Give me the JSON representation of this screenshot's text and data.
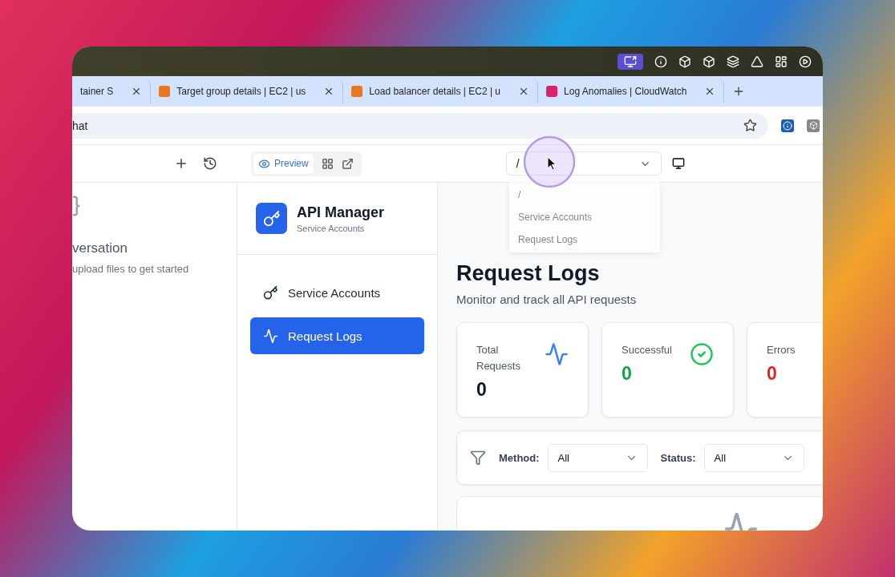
{
  "browser_tabs": [
    {
      "title": "tainer S",
      "selected": false
    },
    {
      "title": "Target group details | EC2 | us",
      "selected": false,
      "color": "#e8771e"
    },
    {
      "title": "Load balancer details | EC2 | u",
      "selected": false,
      "color": "#e8771e"
    },
    {
      "title": "Log Anomalies | CloudWatch",
      "selected": false,
      "color": "#d6246e"
    }
  ],
  "address_bar": {
    "value": "hat"
  },
  "toolbar": {
    "preview_label": "Preview",
    "path_select": {
      "value": "/"
    },
    "path_menu": [
      "/",
      "Service Accounts",
      "Request Logs"
    ]
  },
  "chat_panel": {
    "title": "versation",
    "hint": "upload files to get started"
  },
  "sidebar": {
    "app_name": "API Manager",
    "app_subtitle": "Service Accounts",
    "items": [
      {
        "label": "Service Accounts",
        "kind": "key",
        "selected": false
      },
      {
        "label": "Request Logs",
        "kind": "activity",
        "selected": true
      }
    ]
  },
  "page": {
    "title": "Request Logs",
    "subtitle": "Monitor and track all API requests",
    "stats": [
      {
        "label": "Total Requests",
        "value": "0",
        "kind": "total"
      },
      {
        "label": "Successful",
        "value": "0",
        "kind": "success"
      },
      {
        "label": "Errors",
        "value": "0",
        "kind": "error"
      }
    ],
    "filters": [
      {
        "label": "Method:",
        "value": "All"
      },
      {
        "label": "Status:",
        "value": "All"
      }
    ]
  }
}
